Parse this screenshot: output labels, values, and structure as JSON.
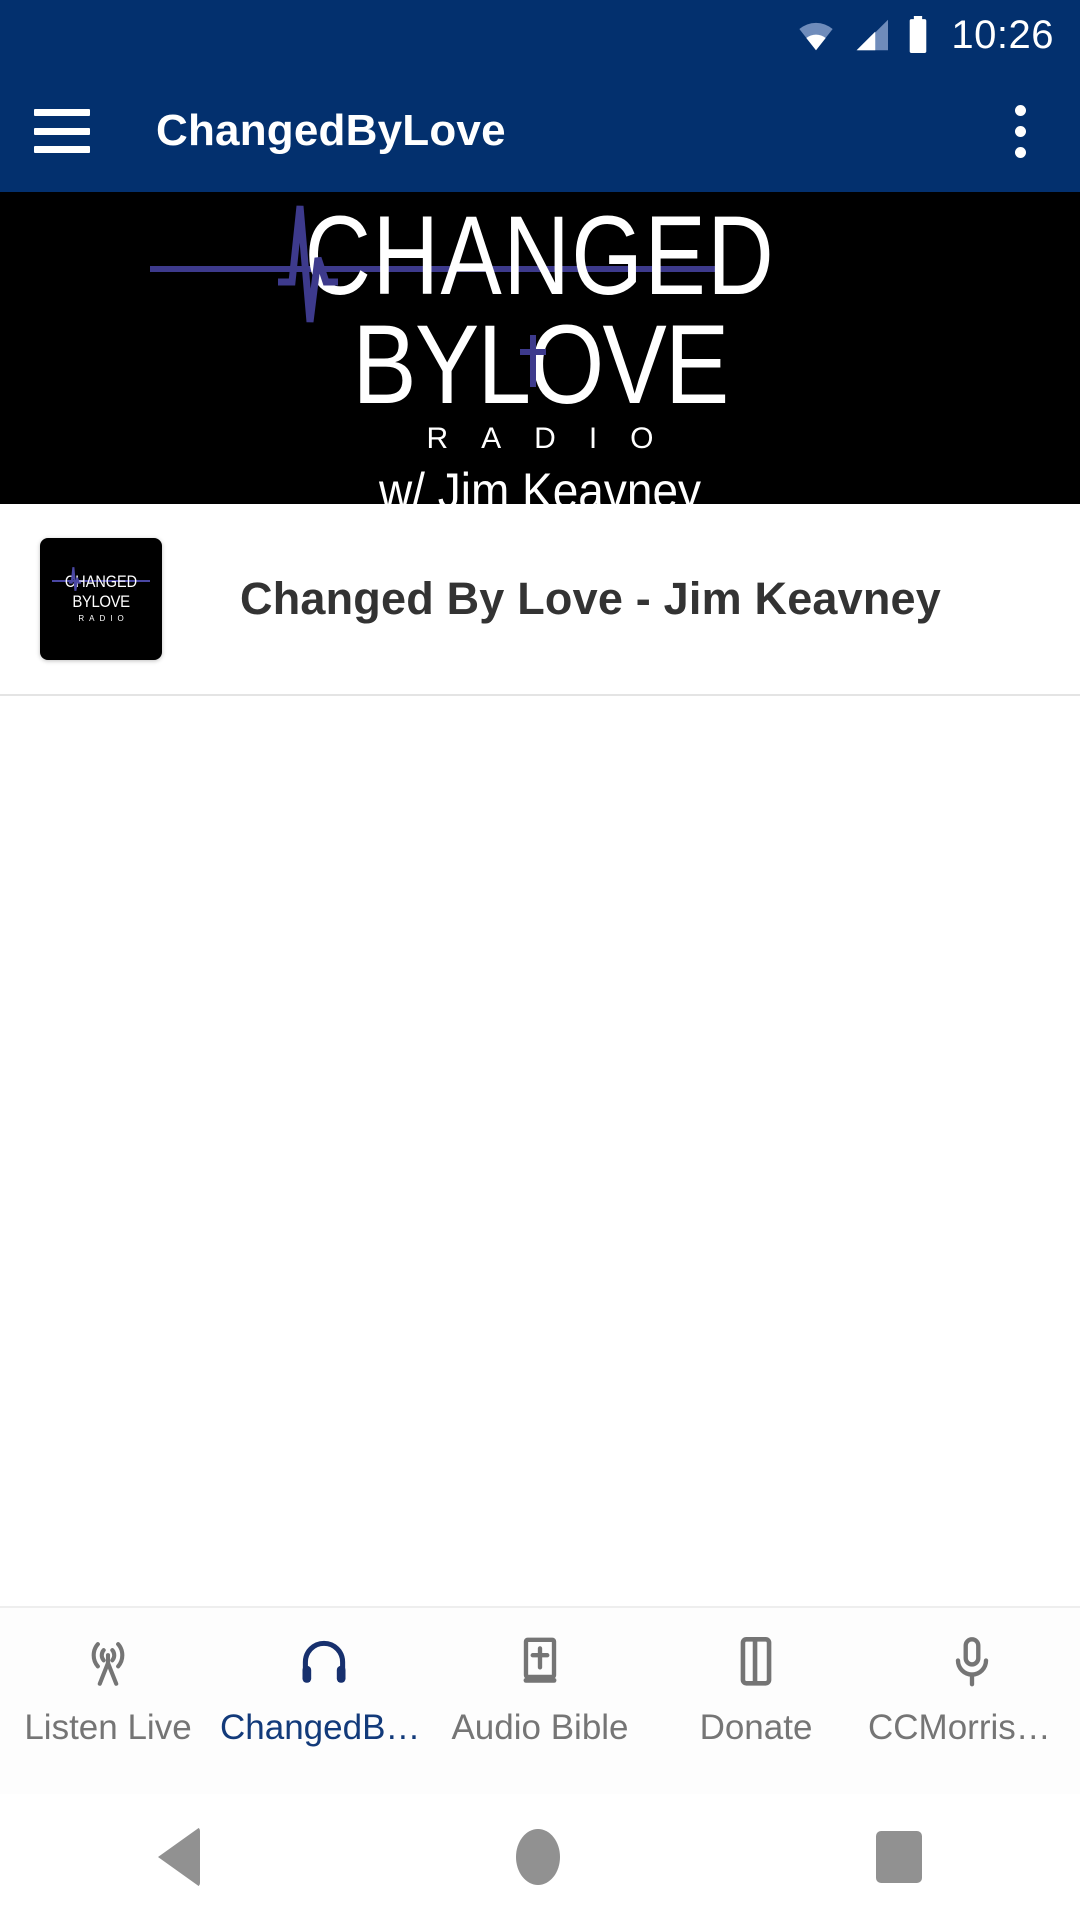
{
  "statusbar": {
    "time": "10:26",
    "icons": [
      "wifi-icon",
      "cellular-signal-icon",
      "battery-icon"
    ]
  },
  "appbar": {
    "menu_icon": "hamburger-menu-icon",
    "title": "ChangedByLove",
    "overflow_icon": "more-vertical-icon"
  },
  "banner": {
    "line1": "CHANGED",
    "line2": "BYLOVE",
    "line3": "RADIO",
    "subtitle": "w/ Jim Keavney",
    "background": "#000000",
    "accent": "#3d3a8c"
  },
  "now_playing": {
    "title": "Changed By Love - Jim Keavney",
    "thumbnail": {
      "line1": "CHANGED",
      "line2": "BYLOVE",
      "line3": "RADIO"
    }
  },
  "tabs": [
    {
      "label": "Listen Live",
      "icon": "broadcast-tower-icon",
      "active": false
    },
    {
      "label": "ChangedBy…",
      "icon": "headphones-icon",
      "active": true
    },
    {
      "label": "Audio Bible",
      "icon": "bible-book-icon",
      "active": false
    },
    {
      "label": "Donate",
      "icon": "book-outline-icon",
      "active": false
    },
    {
      "label": "CCMorrisHi…",
      "icon": "microphone-icon",
      "active": false
    }
  ],
  "android_nav": {
    "back": "back-triangle-icon",
    "home": "home-circle-icon",
    "recents": "recents-square-icon"
  },
  "colors": {
    "toolbar_blue": "#03306E",
    "active_tab": "#123a7a",
    "inactive_tab": "#757575"
  }
}
